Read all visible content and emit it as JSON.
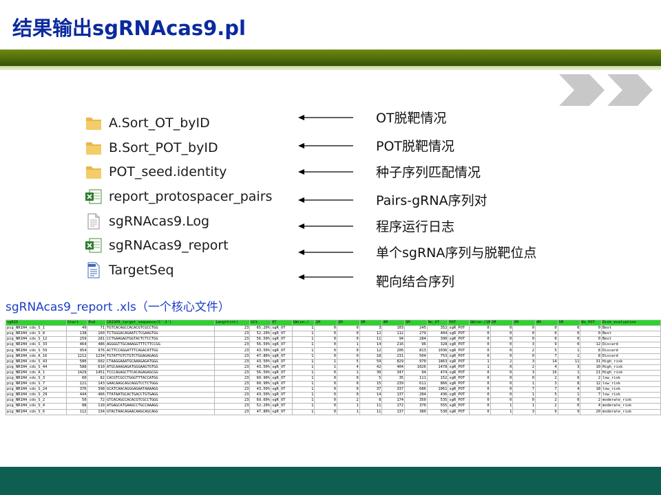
{
  "slide": {
    "title": "结果输出sgRNAcas9.pl",
    "caption": "sgRNAcas9_report .xls（一个核心文件）"
  },
  "files": [
    {
      "name": "A.Sort_OT_byID",
      "icon": "folder-icon",
      "desc": "OT脱靶情况"
    },
    {
      "name": "B.Sort_POT_byID",
      "icon": "folder-icon",
      "desc": "POT脱靶情况"
    },
    {
      "name": "POT_seed.identity",
      "icon": "folder-icon",
      "desc": "种子序列匹配情况"
    },
    {
      "name": "report_protospacer_pairs",
      "icon": "excel-icon",
      "desc": "Pairs-gRNA序列对"
    },
    {
      "name": "sgRNAcas9.Log",
      "icon": "text-file-icon",
      "desc": "程序运行日志"
    },
    {
      "name": "sgRNAcas9_report",
      "icon": "excel-icon",
      "desc": "单个sgRNA序列与脱靶位点"
    },
    {
      "name": "TargetSeq",
      "icon": "document-icon",
      "desc": "靶向结合序列"
    }
  ],
  "colors": {
    "title": "#0a2a9e",
    "caption": "#1a3cc8",
    "band_dark": "#4b6a0a",
    "header_green": "#2bd42b",
    "bottom_band": "#0d5f52"
  },
  "sheet": {
    "headers": [
      "sgRID",
      "Start",
      "End",
      "CRISPR_target_sequence(5'-3')",
      "Length(nt)",
      "GC%",
      "OT",
      "GW(on-/",
      "1M",
      "2M",
      "3M",
      "4M",
      "5M",
      "No_OT",
      "POT",
      "GW(on-/1M",
      "2M",
      "3M",
      "4M",
      "5M",
      "No_POT",
      "Risk_evaluation"
    ],
    "rows": [
      [
        "pig_NR1H4_cds_S_1",
        "49",
        "71",
        "TGTCACAGCCACACGTCGCCTGG",
        "23",
        "65.20%",
        "sgR_OT",
        "1",
        "0",
        "0",
        "3",
        "103",
        "245",
        "352",
        "sgR_POT",
        "1",
        "0",
        "0",
        "0",
        "0",
        "0",
        "0",
        "Best"
      ],
      [
        "pig_NR1H4_cds_S_8",
        "138",
        "160",
        "TCTGGGACAGAATCTCGAAGTGG",
        "23",
        "52.20%",
        "sgR_OT",
        "1",
        "0",
        "0",
        "12",
        "112",
        "279",
        "404",
        "sgR_POT",
        "1",
        "0",
        "0",
        "0",
        "0",
        "0",
        "0",
        "Best"
      ],
      [
        "pig_NR1H4_cds_S_12",
        "259",
        "281",
        "CCTGAAGAGTGGTACTCTCCTGG",
        "23",
        "56.50%",
        "sgR_OT",
        "1",
        "0",
        "0",
        "11",
        "94",
        "284",
        "390",
        "sgR_POT",
        "1",
        "0",
        "0",
        "0",
        "0",
        "0",
        "0",
        "Best"
      ],
      [
        "pig_NR1H4_cds_S_33",
        "464",
        "486",
        "AGGGGTTGCAAAGGTTTCTTCCGG",
        "23",
        "56.50%",
        "sgR_OT",
        "1",
        "0",
        "1",
        "14",
        "216",
        "96",
        "328",
        "sgR_POT",
        "1",
        "0",
        "0",
        "3",
        "9",
        "0",
        "12",
        "Discard"
      ],
      [
        "pig_NR1H4_cds_S_59",
        "954",
        "976",
        "ACTTCCAGGATTTCAGACATTGG",
        "23",
        "43.50%",
        "sgR_OT",
        "1",
        "0",
        "0",
        "12",
        "206",
        "813",
        "1036",
        "sgR_POT",
        "0",
        "0",
        "0",
        "2",
        "5",
        "1",
        "8",
        "Discard"
      ],
      [
        "pig_NR1H4_cds_A_16",
        "1212",
        "1234",
        "TGTATTGTCTGTCTGGAGAGAGG",
        "23",
        "47.80%",
        "sgR_OT",
        "1",
        "0",
        "0",
        "18",
        "231",
        "504",
        "753",
        "sgR_POT",
        "1",
        "0",
        "0",
        "0",
        "7",
        "1",
        "8",
        "Discard"
      ],
      [
        "pig_NR1H4_cds_S_43",
        "580",
        "602",
        "CTAAGGAAATGCAAAGAGATGGG",
        "23",
        "43.50%",
        "sgR_OT",
        "1",
        "1",
        "5",
        "59",
        "829",
        "970",
        "1863",
        "sgR_POT",
        "1",
        "1",
        "2",
        "3",
        "14",
        "11",
        "31",
        "High_risk"
      ],
      [
        "pig_NR1H4_cds_S_44",
        "588",
        "610",
        "ATGCAAAGAGATGGGAAGTGTGG",
        "23",
        "43.50%",
        "sgR_OT",
        "1",
        "1",
        "4",
        "42",
        "404",
        "1026",
        "1478",
        "sgR_POT",
        "1",
        "1",
        "0",
        "2",
        "4",
        "3",
        "10",
        "High_risk"
      ],
      [
        "pig_NR1H4_cds_A_1",
        "1429",
        "1451",
        "TCCCAGAGCTTCACAGAGAGCGG",
        "23",
        "56.50%",
        "sgR_OT",
        "1",
        "0",
        "1",
        "30",
        "347",
        "94",
        "474",
        "sgR_POT",
        "1",
        "0",
        "0",
        "3",
        "16",
        "1",
        "21",
        "High_risk"
      ],
      [
        "pig_NR1H4_cds_S_3",
        "60",
        "82",
        "CACGTCGCCTGGGTTTACCATGG",
        "23",
        "60.90%",
        "sgR_OT",
        "1",
        "0",
        "0",
        "5",
        "35",
        "111",
        "152",
        "sgR_POT",
        "1",
        "0",
        "0",
        "0",
        "2",
        "0",
        "2",
        "low_risk"
      ],
      [
        "pig_NR1H4_cds_S_7",
        "121",
        "143",
        "GAACAAGCAGCAGGTCCTCTGGG",
        "23",
        "60.90%",
        "sgR_OT",
        "1",
        "0",
        "0",
        "15",
        "239",
        "611",
        "866",
        "sgR_POT",
        "1",
        "0",
        "0",
        "1",
        "3",
        "8",
        "12",
        "low_risk"
      ],
      [
        "pig_NR1H4_cds_S_24",
        "376",
        "398",
        "GCATCAACAGGGAGAATAAAAGG",
        "23",
        "43.50%",
        "sgR_OT",
        "1",
        "0",
        "0",
        "37",
        "337",
        "686",
        "1061",
        "sgR_POT",
        "1",
        "0",
        "0",
        "7",
        "7",
        "4",
        "18",
        "low_risk"
      ],
      [
        "pig_NR1H4_cds_S_29",
        "444",
        "466",
        "TTATAATGCACTGACCTGTGAGG",
        "23",
        "43.50%",
        "sgR_OT",
        "1",
        "0",
        "0",
        "14",
        "137",
        "284",
        "436",
        "sgR_POT",
        "1",
        "0",
        "0",
        "1",
        "5",
        "1",
        "7",
        "low_risk"
      ],
      [
        "pig_NR1H4_cds_S_2",
        "50",
        "72",
        "GTCACAGCCACACGTCGCCTGGG",
        "23",
        "69.60%",
        "sgR_OT",
        "1",
        "0",
        "2",
        "8",
        "174",
        "350",
        "535",
        "sgR_POT",
        "1",
        "0",
        "0",
        "0",
        "2",
        "0",
        "2",
        "moderate_risk"
      ],
      [
        "pig_NR1H4_cds_S_4",
        "88",
        "110",
        "ATGAGCATGAAGCCTGCCAAAGG",
        "23",
        "52.20%",
        "sgR_OT",
        "1",
        "0",
        "1",
        "11",
        "172",
        "370",
        "555",
        "sgR_POT",
        "1",
        "0",
        "1",
        "1",
        "2",
        "0",
        "4",
        "moderate_risk"
      ],
      [
        "pig_NR1H4_cds_S_6",
        "112",
        "134",
        "GTACTAACAGAACAAGCAGCAGG",
        "23",
        "47.80%",
        "sgR_OT",
        "1",
        "0",
        "1",
        "11",
        "137",
        "380",
        "530",
        "sgR_POT",
        "1",
        "0",
        "1",
        "3",
        "9",
        "9",
        "20",
        "moderate_risk"
      ]
    ]
  }
}
